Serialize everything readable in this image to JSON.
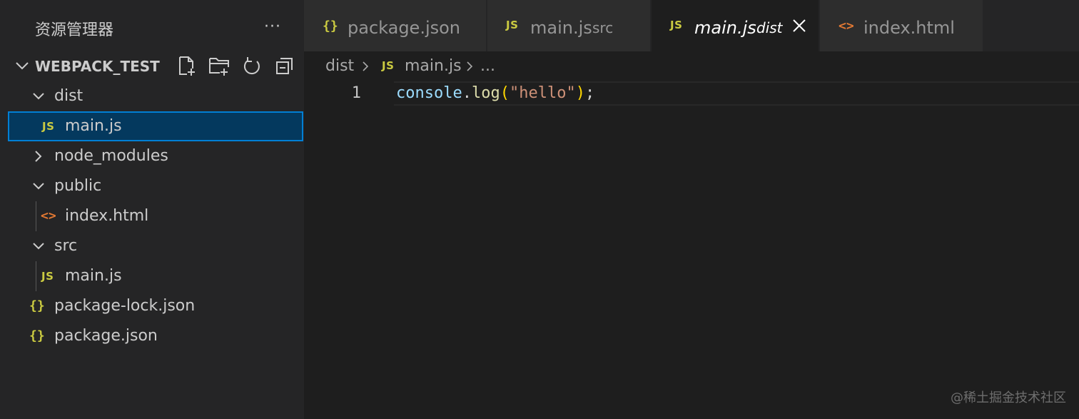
{
  "sidebar": {
    "title": "资源管理器",
    "more": "···",
    "section_title": "WEBPACK_TEST",
    "tree": [
      {
        "label": "dist",
        "badge": "",
        "kind": "folder-open"
      },
      {
        "label": "main.js",
        "badge": "JS",
        "kind": "js-file"
      },
      {
        "label": "node_modules",
        "badge": "",
        "kind": "folder-closed"
      },
      {
        "label": "public",
        "badge": "",
        "kind": "folder-open"
      },
      {
        "label": "index.html",
        "badge": "<>",
        "kind": "html-file"
      },
      {
        "label": "src",
        "badge": "",
        "kind": "folder-open"
      },
      {
        "label": "main.js",
        "badge": "JS",
        "kind": "js-file"
      },
      {
        "label": "package-lock.json",
        "badge": "{}",
        "kind": "json-file"
      },
      {
        "label": "package.json",
        "badge": "{}",
        "kind": "json-file"
      }
    ]
  },
  "tabs": [
    {
      "badge": "{}",
      "label": "package.json",
      "desc": ""
    },
    {
      "badge": "JS",
      "label": "main.js",
      "desc": "src"
    },
    {
      "badge": "JS",
      "label": "main.js",
      "desc": "dist",
      "active": true
    },
    {
      "badge": "<>",
      "label": "index.html",
      "desc": ""
    }
  ],
  "breadcrumb": {
    "folder": "dist",
    "badge": "JS",
    "file": "main.js",
    "more": "..."
  },
  "editor": {
    "line_number": "1",
    "tokens": {
      "obj": "console",
      "dot": ".",
      "fn": "log",
      "lp": "(",
      "str": "\"hello\"",
      "rp": ")",
      "semi": ";"
    }
  },
  "watermark": "@稀土掘金技术社区",
  "colors": {
    "accent": "#007fd4",
    "selected_bg": "#04395e",
    "js_yellow": "#cbcb41",
    "html_orange": "#e37933"
  }
}
